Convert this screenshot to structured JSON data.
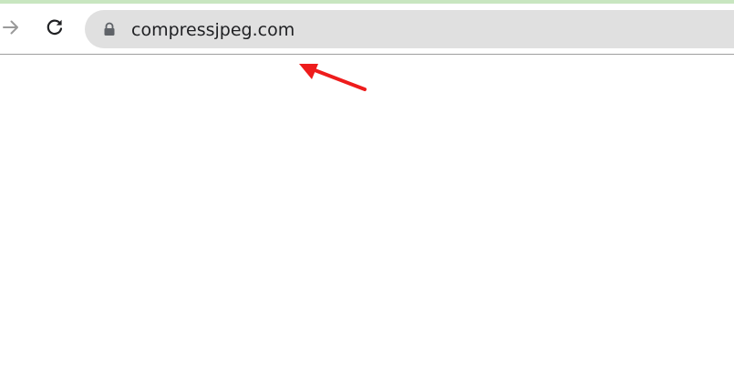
{
  "browser": {
    "address_bar": {
      "url": "compressjpeg.com"
    },
    "icons": {
      "forward": "arrow-right-icon",
      "reload": "reload-icon",
      "secure": "lock-icon"
    }
  },
  "colors": {
    "tab_strip_accent": "#c8e6c0",
    "omnibox_background": "#e0e0e0",
    "annotation_arrow": "#ee1c1c"
  }
}
